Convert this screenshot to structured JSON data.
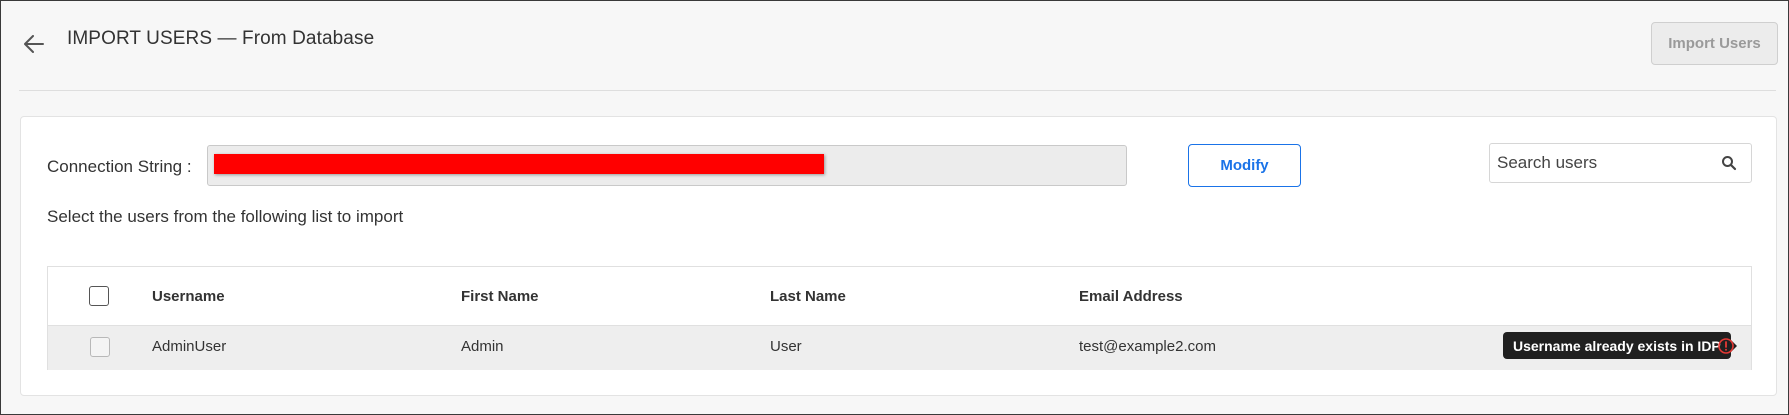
{
  "header": {
    "title": "IMPORT USERS — From Database",
    "back_icon": "arrow-left-icon",
    "import_button_label": "Import Users"
  },
  "connection": {
    "label": "Connection String :",
    "value_redacted": true,
    "modify_label": "Modify"
  },
  "search": {
    "placeholder": "Search users",
    "icon": "search-icon"
  },
  "instructions": "Select the users from the following list to import",
  "table": {
    "columns": [
      "Username",
      "First Name",
      "Last Name",
      "Email Address"
    ],
    "rows": [
      {
        "username": "AdminUser",
        "first_name": "Admin",
        "last_name": "User",
        "email": "test@example2.com",
        "warning": "Username already exists in IDP"
      }
    ]
  },
  "colors": {
    "accent": "#1a73e8",
    "warning": "#e53935",
    "redaction": "#ff0000"
  }
}
